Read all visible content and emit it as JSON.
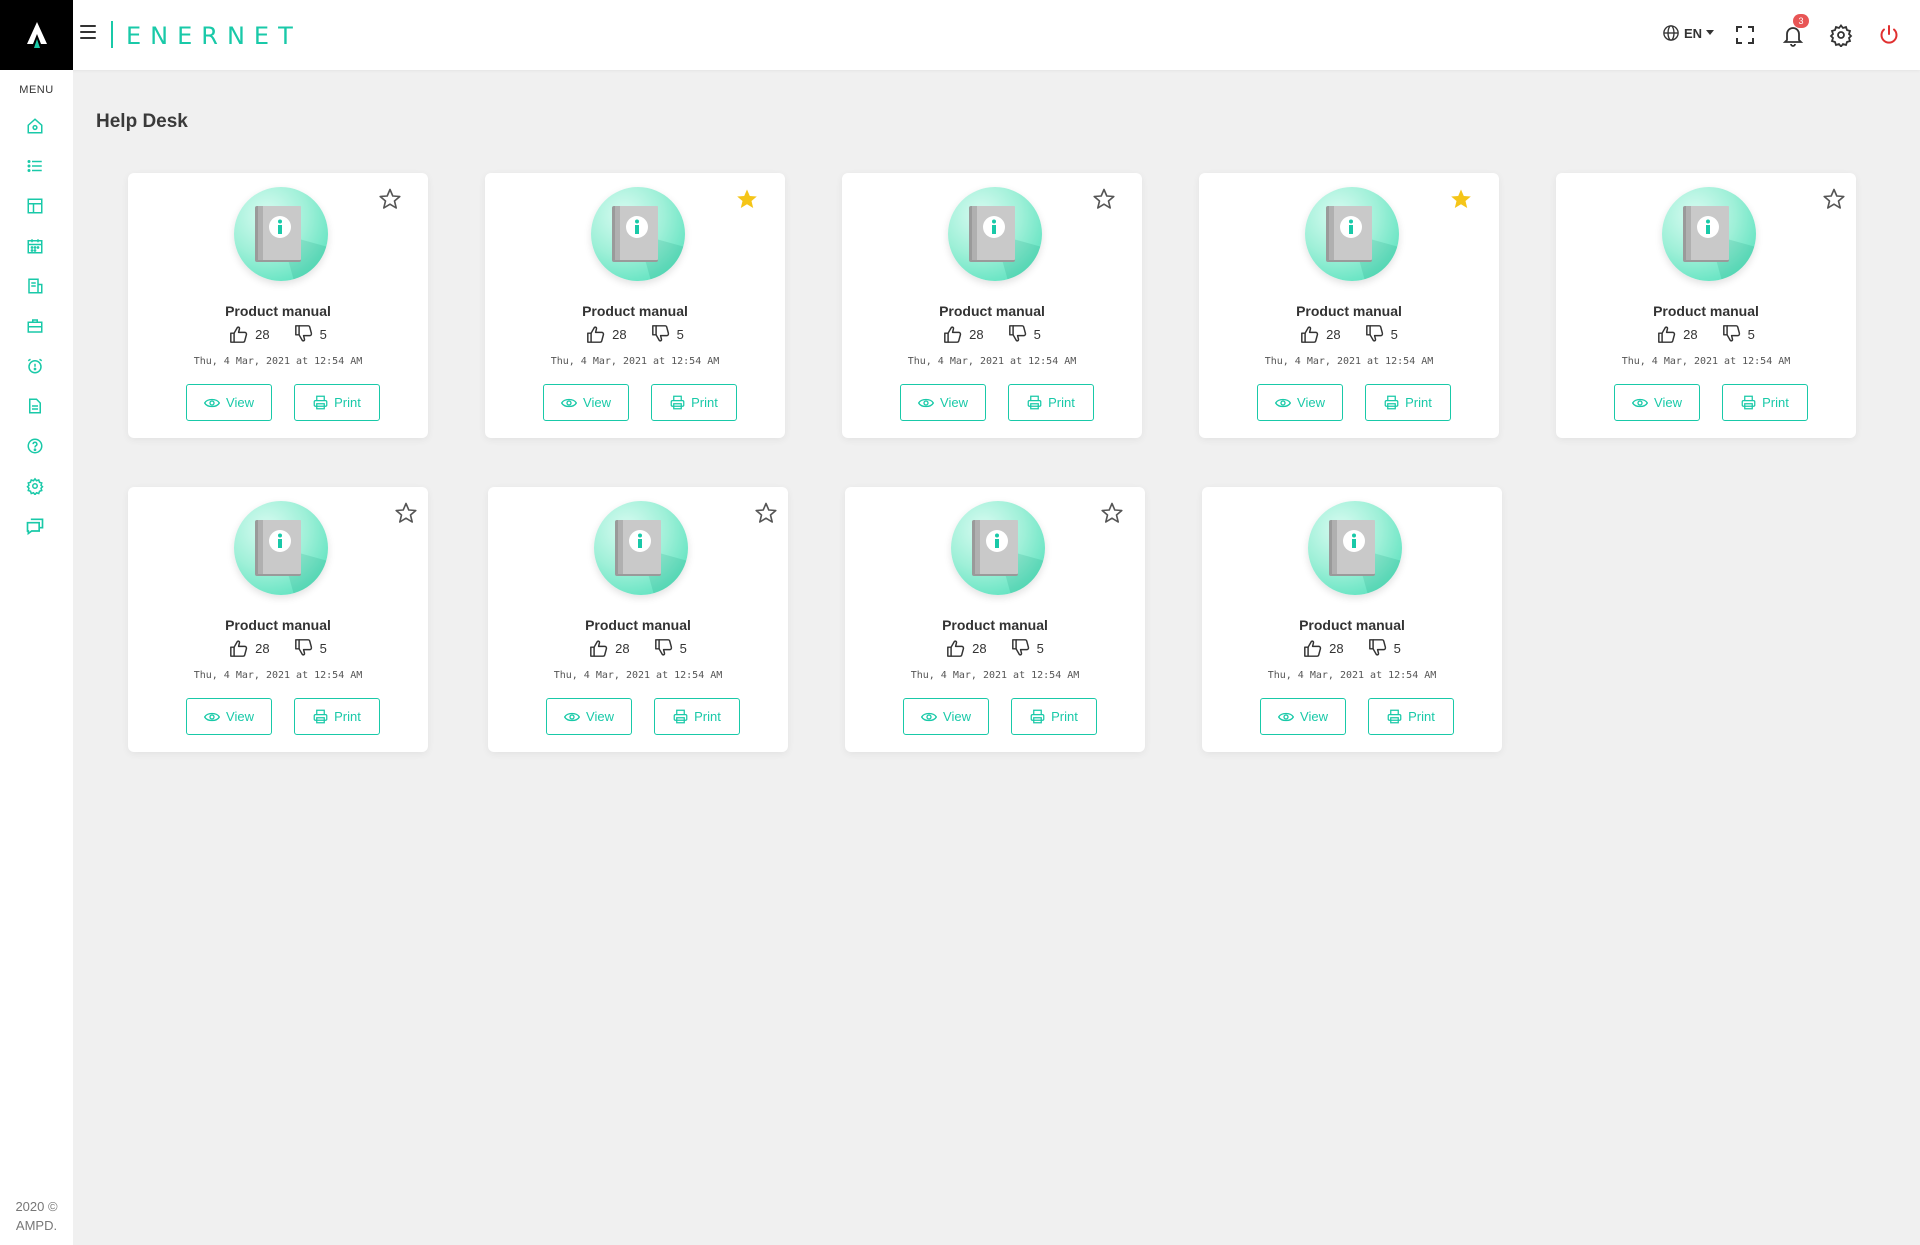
{
  "header": {
    "brand": "ENERNET",
    "language": "EN",
    "notification_count": "3"
  },
  "sidebar": {
    "menu_label": "MENU",
    "footer_line1": "2020 ©",
    "footer_line2": "AMPD.",
    "items": [
      {
        "name": "home-icon"
      },
      {
        "name": "list-icon"
      },
      {
        "name": "layout-icon"
      },
      {
        "name": "calendar-icon"
      },
      {
        "name": "document-edit-icon"
      },
      {
        "name": "briefcase-icon"
      },
      {
        "name": "alarm-icon"
      },
      {
        "name": "file-icon"
      },
      {
        "name": "help-icon"
      },
      {
        "name": "gear-icon"
      },
      {
        "name": "chat-icon"
      }
    ]
  },
  "page": {
    "title": "Help Desk"
  },
  "colors": {
    "accent": "#19c9a8",
    "star_filled": "#f5c518",
    "badge": "#e85656",
    "power": "#e03030"
  },
  "cards": [
    {
      "title": "Product manual",
      "likes": "28",
      "dislikes": "5",
      "date": "Thu, 4 Mar, 2021 at 12:54 AM",
      "starred": false,
      "view_label": "View",
      "print_label": "Print"
    },
    {
      "title": "Product manual",
      "likes": "28",
      "dislikes": "5",
      "date": "Thu, 4 Mar, 2021 at 12:54 AM",
      "starred": true,
      "view_label": "View",
      "print_label": "Print"
    },
    {
      "title": "Product manual",
      "likes": "28",
      "dislikes": "5",
      "date": "Thu, 4 Mar, 2021 at 12:54 AM",
      "starred": false,
      "view_label": "View",
      "print_label": "Print"
    },
    {
      "title": "Product manual",
      "likes": "28",
      "dislikes": "5",
      "date": "Thu, 4 Mar, 2021 at 12:54 AM",
      "starred": true,
      "view_label": "View",
      "print_label": "Print"
    },
    {
      "title": "Product manual",
      "likes": "28",
      "dislikes": "5",
      "date": "Thu, 4 Mar, 2021 at 12:54 AM",
      "starred": false,
      "view_label": "View",
      "print_label": "Print"
    },
    {
      "title": "Product manual",
      "likes": "28",
      "dislikes": "5",
      "date": "Thu, 4 Mar, 2021 at 12:54 AM",
      "starred": false,
      "view_label": "View",
      "print_label": "Print"
    },
    {
      "title": "Product manual",
      "likes": "28",
      "dislikes": "5",
      "date": "Thu, 4 Mar, 2021 at 12:54 AM",
      "starred": false,
      "view_label": "View",
      "print_label": "Print"
    },
    {
      "title": "Product manual",
      "likes": "28",
      "dislikes": "5",
      "date": "Thu, 4 Mar, 2021 at 12:54 AM",
      "starred": false,
      "view_label": "View",
      "print_label": "Print"
    },
    {
      "title": "Product manual",
      "likes": "28",
      "dislikes": "5",
      "date": "Thu, 4 Mar, 2021 at 12:54 AM",
      "starred": null,
      "view_label": "View",
      "print_label": "Print"
    }
  ]
}
